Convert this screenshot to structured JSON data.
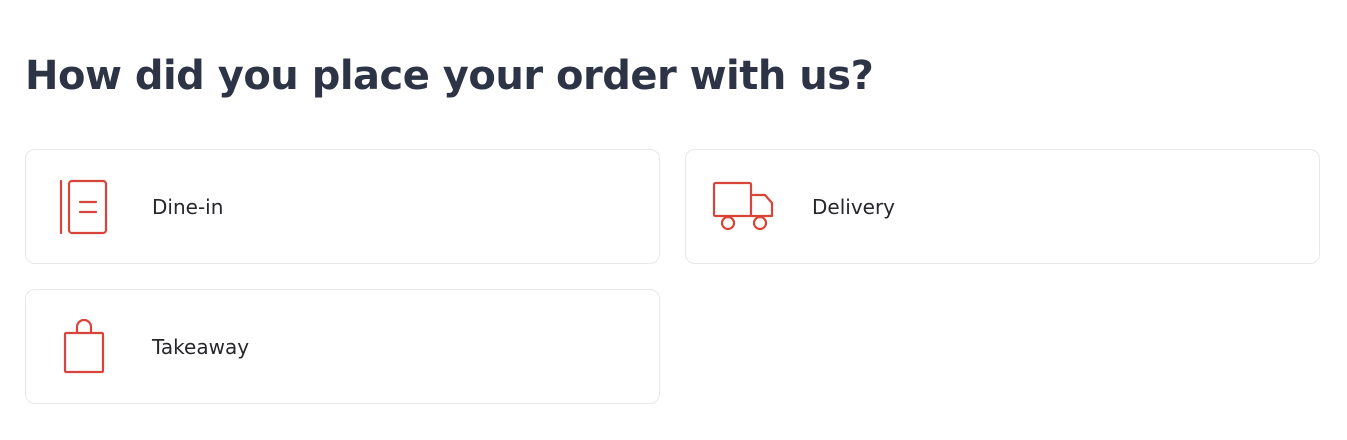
{
  "question": {
    "title": "How did you place your order with us?"
  },
  "colors": {
    "heading": "#2c3446",
    "icon_accent": "#d9443a",
    "card_border": "#e8e8ec",
    "label": "#26272b"
  },
  "options": [
    {
      "label": "Dine-in",
      "icon": "menu-book-icon"
    },
    {
      "label": "Delivery",
      "icon": "delivery-truck-icon"
    },
    {
      "label": "Takeaway",
      "icon": "shopping-bag-icon"
    }
  ]
}
